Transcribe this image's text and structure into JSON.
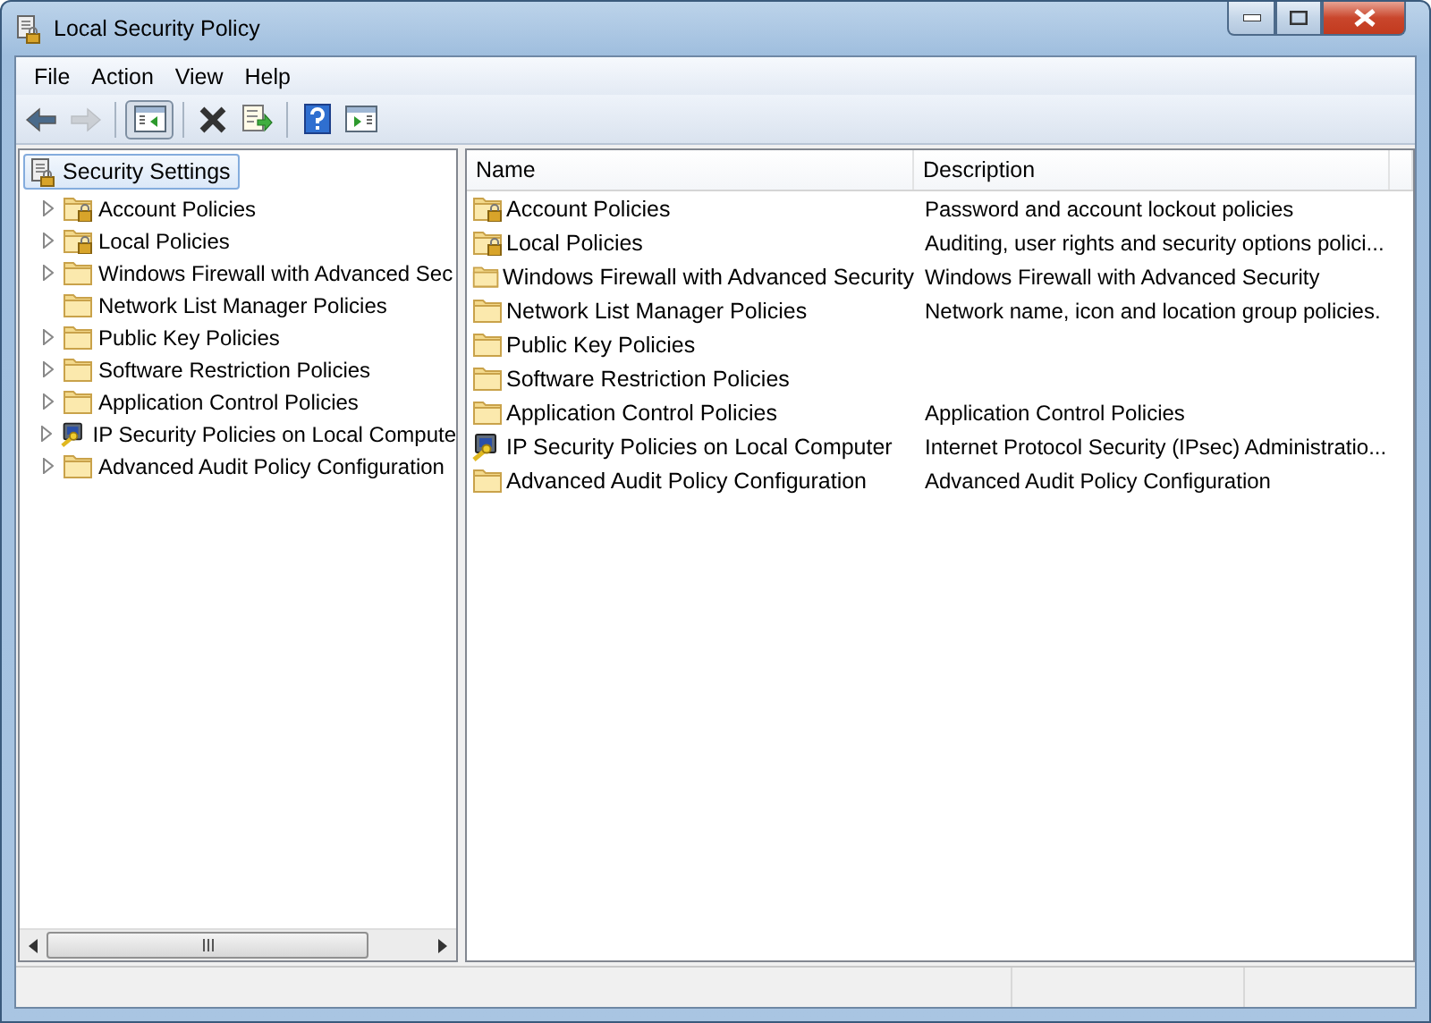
{
  "window": {
    "title": "Local Security Policy"
  },
  "menu": [
    {
      "label": "File"
    },
    {
      "label": "Action"
    },
    {
      "label": "View"
    },
    {
      "label": "Help"
    }
  ],
  "toolbar": [
    {
      "kind": "back",
      "disabled": false,
      "pressed": false
    },
    {
      "kind": "forward",
      "disabled": true,
      "pressed": false
    },
    {
      "kind": "sep"
    },
    {
      "kind": "tree",
      "disabled": false,
      "pressed": true
    },
    {
      "kind": "sep"
    },
    {
      "kind": "delete",
      "disabled": false,
      "pressed": false
    },
    {
      "kind": "export",
      "disabled": false,
      "pressed": false
    },
    {
      "kind": "sep"
    },
    {
      "kind": "help",
      "disabled": false,
      "pressed": false
    },
    {
      "kind": "actionpane",
      "disabled": false,
      "pressed": false
    }
  ],
  "tree": {
    "root": {
      "label": "Security Settings",
      "selected": true
    },
    "items": [
      {
        "label": "Account Policies",
        "kind": "lockfolder",
        "expandable": true
      },
      {
        "label": "Local Policies",
        "kind": "lockfolder",
        "expandable": true
      },
      {
        "label": "Windows Firewall with Advanced Sec",
        "kind": "folder",
        "expandable": true
      },
      {
        "label": "Network List Manager Policies",
        "kind": "folder",
        "expandable": false
      },
      {
        "label": "Public Key Policies",
        "kind": "folder",
        "expandable": true
      },
      {
        "label": "Software Restriction Policies",
        "kind": "folder",
        "expandable": true
      },
      {
        "label": "Application Control Policies",
        "kind": "folder",
        "expandable": true
      },
      {
        "label": "IP Security Policies on Local Compute",
        "kind": "ipsec",
        "expandable": true
      },
      {
        "label": "Advanced Audit Policy Configuration",
        "kind": "folder",
        "expandable": true
      }
    ]
  },
  "table": {
    "columns": [
      "Name",
      "Description"
    ],
    "rows": [
      {
        "kind": "lockfolder",
        "name": "Account Policies",
        "description": "Password and account lockout policies"
      },
      {
        "kind": "lockfolder",
        "name": "Local Policies",
        "description": "Auditing, user rights and security options polici..."
      },
      {
        "kind": "folder",
        "name": "Windows Firewall with Advanced Security",
        "description": "Windows Firewall with Advanced Security"
      },
      {
        "kind": "folder",
        "name": "Network List Manager Policies",
        "description": "Network name, icon and location group policies."
      },
      {
        "kind": "folder",
        "name": "Public Key Policies"
      },
      {
        "kind": "folder",
        "name": "Software Restriction Policies"
      },
      {
        "kind": "folder",
        "name": "Application Control Policies",
        "description": "Application Control Policies"
      },
      {
        "kind": "ipsec",
        "name": "IP Security Policies on Local Computer",
        "description": "Internet Protocol Security (IPsec) Administratio..."
      },
      {
        "kind": "folder",
        "name": "Advanced Audit Policy Configuration",
        "description": "Advanced Audit Policy Configuration"
      }
    ]
  }
}
